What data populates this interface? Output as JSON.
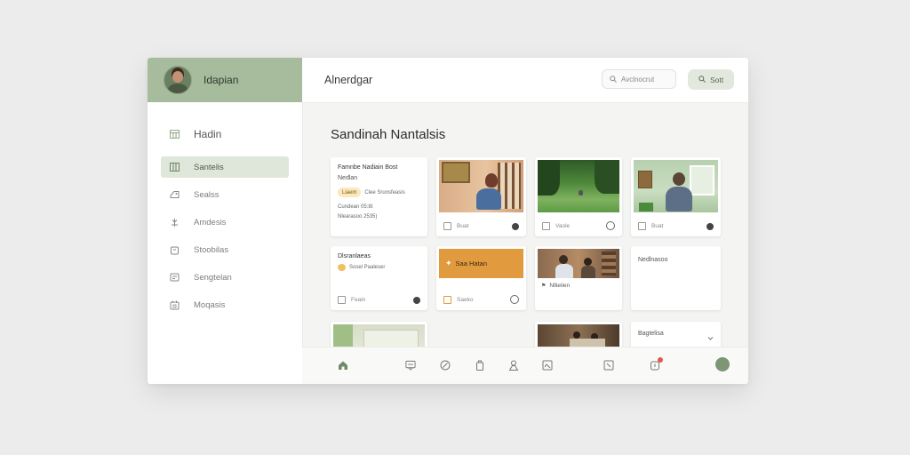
{
  "sidebar": {
    "username": "Idapian",
    "top_item": "Hadin",
    "items": [
      {
        "label": "Santelis",
        "icon": "grid-icon",
        "active": true
      },
      {
        "label": "Sealss",
        "icon": "tag-icon"
      },
      {
        "label": "Amdesis",
        "icon": "spark-icon"
      },
      {
        "label": "Stoobilas",
        "icon": "box-icon"
      },
      {
        "label": "Sengtelan",
        "icon": "folder-icon"
      },
      {
        "label": "Moqasis",
        "icon": "calendar-icon"
      }
    ]
  },
  "header": {
    "title": "Alnerdgar",
    "search_placeholder": "Avclnocrut",
    "sort_label": "Sott"
  },
  "main": {
    "page_title": "Sandinah Nantalsis",
    "cards": {
      "c1": {
        "title": "Famnbe Nadiain Bost",
        "sub": "Nedlan",
        "pill": "Liaem",
        "pill_text": "Clee Srunsfeasis",
        "line1": "Cundean 05:8t",
        "line2": "Nlearasoo 2535)"
      },
      "c2": {
        "label": "Buat"
      },
      "c3": {
        "label": "Vaole"
      },
      "c4": {
        "label": "Buat"
      },
      "c5": {
        "title": "Dlsranlaeas",
        "line": "Sosel Paaleser"
      },
      "c5_foot": "Feain",
      "c6": {
        "banner": "Saa Hatan",
        "foot": "Saeko"
      },
      "c7": {
        "foot": "Nllieilen"
      },
      "c8": {
        "label": "Nedlnasoo"
      },
      "c9": {
        "label": "Bagtelisa"
      }
    }
  },
  "colors": {
    "accent": "#a7bb9d",
    "active_nav": "#dfe7da",
    "banner": "#e19a3e",
    "notification": "#e05a4a"
  }
}
